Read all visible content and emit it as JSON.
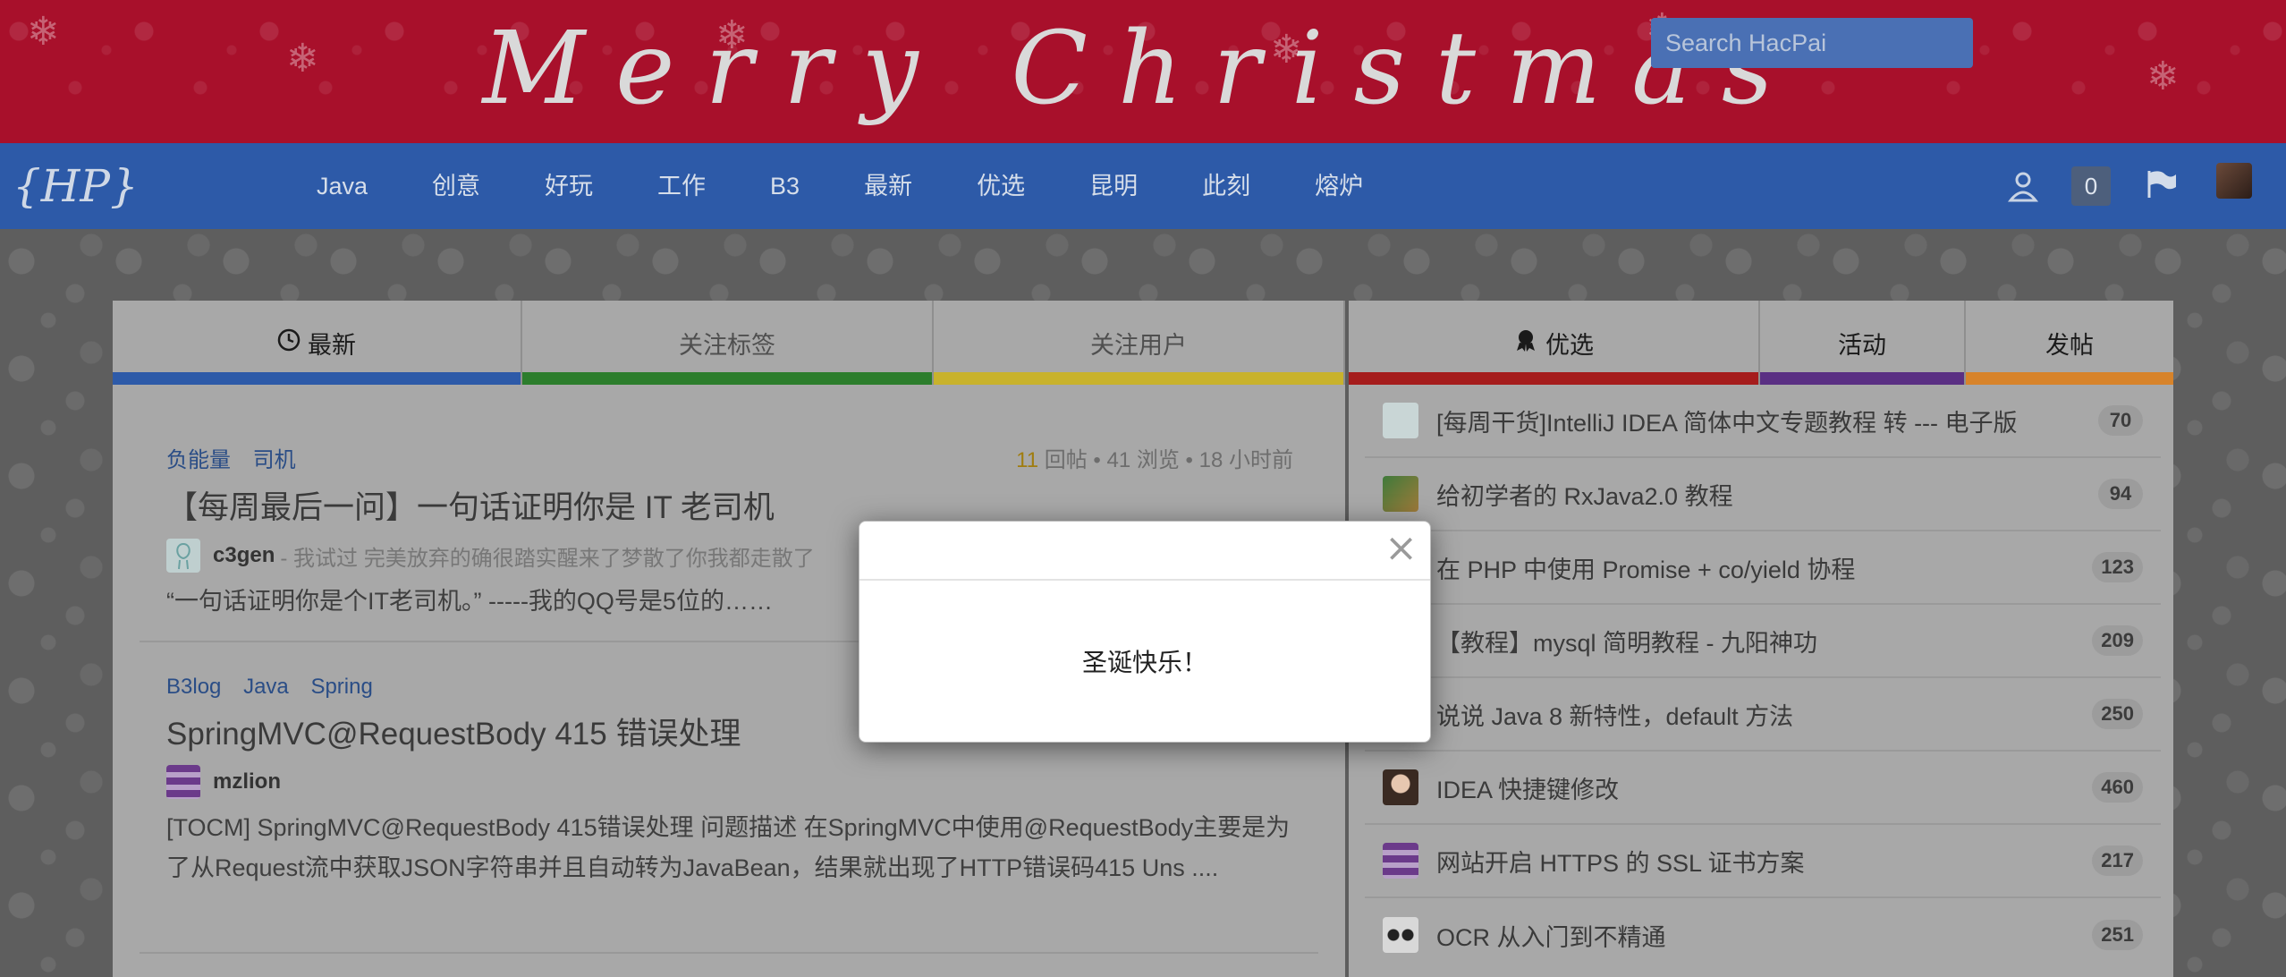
{
  "banner": {
    "title": "Merry Christmas"
  },
  "navbar": {
    "logo": "{HP}",
    "items": [
      "Java",
      "创意",
      "好玩",
      "工作",
      "B3",
      "最新",
      "优选",
      "昆明",
      "此刻",
      "熔炉"
    ],
    "search_placeholder": "Search HacPai",
    "notification_count": "0"
  },
  "tabs": {
    "left": [
      {
        "label": "最新",
        "icon": "clock-icon",
        "color": "#2d5aa8"
      },
      {
        "label": "关注标签",
        "color": "#2c7d2c"
      },
      {
        "label": "关注用户",
        "color": "#c8b22c"
      }
    ],
    "right": [
      {
        "label": "优选",
        "icon": "award-icon",
        "color": "#a51c1c"
      },
      {
        "label": "活动",
        "color": "#5a2f83"
      },
      {
        "label": "发帖",
        "color": "#d7832a"
      }
    ]
  },
  "articles": [
    {
      "tags": [
        "负能量",
        "司机"
      ],
      "replies": "11",
      "replies_label": "回帖",
      "views": "41 浏览",
      "time": "18 小时前",
      "title": "【每周最后一问】一句话证明你是 IT 老司机",
      "author": "c3gen",
      "signature": "- 我试过 完美放弃的确很踏实醒来了梦散了你我都走散了",
      "excerpt": "“一句话证明你是个IT老司机。” -----我的QQ号是5位的……"
    },
    {
      "tags": [
        "B3log",
        "Java",
        "Spring"
      ],
      "title": "SpringMVC@RequestBody 415 错误处理",
      "author": "mzlion",
      "excerpt": "[TOCM] SpringMVC@RequestBody 415错误处理 问题描述 在SpringMVC中使用@RequestBody主要是为了从Request流中获取JSON字符串并且自动转为JavaBean，结果就出现了HTTP错误码415 Uns ...."
    }
  ],
  "featured": [
    {
      "title": "[每周干货]IntelliJ IDEA 简体中文专题教程 转 --- 电子版",
      "count": "70"
    },
    {
      "title": "给初学者的 RxJava2.0 教程",
      "count": "94"
    },
    {
      "title": "在 PHP 中使用 Promise + co/yield 协程",
      "count": "123"
    },
    {
      "title": "【教程】mysql 简明教程 - 九阳神功",
      "count": "209"
    },
    {
      "title": "说说 Java 8 新特性，default 方法",
      "count": "250"
    },
    {
      "title": "IDEA 快捷键修改",
      "count": "460"
    },
    {
      "title": "网站开启 HTTPS 的 SSL 证书方案",
      "count": "217"
    },
    {
      "title": "OCR 从入门到不精通",
      "count": "251"
    }
  ],
  "modal": {
    "message": "圣诞快乐！",
    "close": "×"
  }
}
